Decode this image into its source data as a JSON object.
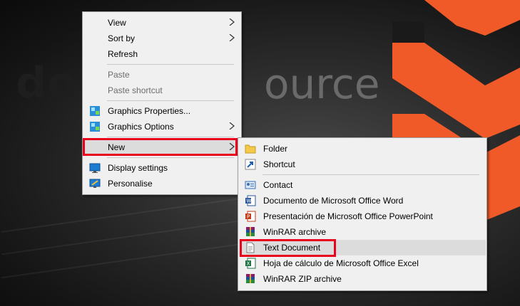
{
  "wallpaper": {
    "logo_left": "do",
    "logo_right": "ource",
    "accent_color": "#f05a28"
  },
  "context_menu": {
    "items": [
      {
        "label": "View",
        "submenu": true
      },
      {
        "label": "Sort by",
        "submenu": true
      },
      {
        "label": "Refresh"
      },
      {
        "label": "Paste",
        "disabled": true
      },
      {
        "label": "Paste shortcut",
        "disabled": true
      },
      {
        "label": "Graphics Properties...",
        "icon": "intel-graphics-icon"
      },
      {
        "label": "Graphics Options",
        "icon": "intel-graphics-icon",
        "submenu": true
      },
      {
        "label": "New",
        "submenu": true,
        "highlighted": true
      },
      {
        "label": "Display settings",
        "icon": "display-icon"
      },
      {
        "label": "Personalise",
        "icon": "personalise-icon"
      }
    ]
  },
  "new_submenu": {
    "items": [
      {
        "label": "Folder",
        "icon": "folder-icon"
      },
      {
        "label": "Shortcut",
        "icon": "shortcut-icon"
      },
      {
        "label": "Contact",
        "icon": "contact-icon"
      },
      {
        "label": "Documento de Microsoft Office Word",
        "icon": "word-icon"
      },
      {
        "label": "Presentación de Microsoft Office PowerPoint",
        "icon": "powerpoint-icon"
      },
      {
        "label": "WinRAR archive",
        "icon": "winrar-icon"
      },
      {
        "label": "Text Document",
        "icon": "text-document-icon",
        "highlighted": true
      },
      {
        "label": "Hoja de cálculo de Microsoft Office Excel",
        "icon": "excel-icon"
      },
      {
        "label": "WinRAR ZIP archive",
        "icon": "winrar-zip-icon"
      }
    ]
  },
  "colors": {
    "highlight_box": "#e8001c",
    "menu_bg": "#f0f0f0"
  }
}
